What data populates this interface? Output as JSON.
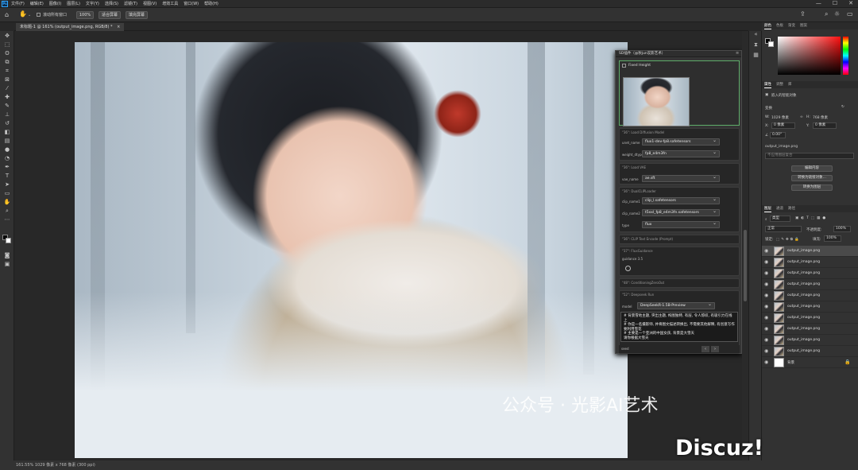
{
  "menubar": {
    "items": [
      "文件(F)",
      "编辑(E)",
      "图像(I)",
      "图层(L)",
      "文字(Y)",
      "选择(S)",
      "滤镜(T)",
      "视图(V)",
      "增效工具",
      "窗口(W)",
      "帮助(H)"
    ],
    "window_controls": [
      "—",
      "☐",
      "✕"
    ]
  },
  "options": {
    "scroll_all": "滚动所有窗口",
    "zoom": "100%",
    "fit_screen": "适合屏幕",
    "fill_screen": "填充屏幕"
  },
  "document_tab": {
    "label": "未标题-1 @ 161% (output_image.png, RGB/8) *",
    "close": "×"
  },
  "comfy": {
    "title": "SD插件（@秋jun炭影艺术）",
    "fixed_height": "Fixed Height",
    "nodes": [
      {
        "title": "\"36\": Load Diffusion Model",
        "fields": [
          {
            "label": "unet_name",
            "value": "flux1-dev-fp8.safetensors"
          },
          {
            "label": "weight_dtype",
            "value": "fp8_e4m3fn"
          }
        ]
      },
      {
        "title": "\"36\": Load VAE",
        "fields": [
          {
            "label": "vae_name",
            "value": "ae.sft"
          }
        ]
      },
      {
        "title": "\"36\": DualCLIPLoader",
        "fields": [
          {
            "label": "clip_name1",
            "value": "clip_l.safetensors"
          },
          {
            "label": "clip_name2",
            "value": "t5xxl_fp8_e4m3fn.safetensors"
          },
          {
            "label": "type",
            "value": "flux"
          }
        ]
      },
      {
        "title": "\"36\": CLIP Text Encode (Prompt)",
        "fields": []
      },
      {
        "title": "\"37\": FluxGuidance",
        "fields": [
          {
            "label": "guidance 3.5",
            "value": ""
          }
        ]
      },
      {
        "title": "\"48\": ConditioningZeroOut",
        "fields": []
      },
      {
        "title": "\"52\": Deepseek Run",
        "fields": [
          {
            "label": "model",
            "value": "DeepSeekR-1.5B-Preview"
          }
        ]
      }
    ],
    "prompt_text": "# 背景雪地主题, 突出主题, 构图独特, 有层, 令人惊叹, 有吸引力在线上\n# 你是一名摄影师, 并将图文描述转换出, 不需要其他解释, 有创意写作要利用雪花\n# 主要是一个亚洲的中国女孩, 背景是大雪天\n请你根据大雪天",
    "seed_label": "seed"
  },
  "right": {
    "color_tabs": [
      "颜色",
      "色板",
      "渐变",
      "图案"
    ],
    "prop_tabs": [
      "属性",
      "调整",
      "库"
    ],
    "smart_object": "嵌入的智能对象",
    "transform": "变换",
    "w_label": "W:",
    "w_value": "1029 像素",
    "h_label": "H:",
    "h_value": "768 像素",
    "x_label": "X:",
    "x_value": "0 像素",
    "y_label": "Y:",
    "y_value": "0 像素",
    "angle_value": "0.00°",
    "filename": "output_image.png",
    "layer_comp": "不应用图层复合",
    "btn_edit": "编辑内容",
    "btn_convert_linked": "转换为链接对象...",
    "btn_convert_layers": "转换为图层",
    "layer_tabs": [
      "图层",
      "通道",
      "路径"
    ],
    "kind_filter": "类型",
    "blend_mode": "正常",
    "opacity_label": "不透明度:",
    "opacity_value": "100%",
    "lock_label": "锁定:",
    "fill_label": "填充:",
    "fill_value": "100%",
    "layers": [
      "output_image.png",
      "output_image.png",
      "output_image.png",
      "output_image.png",
      "output_image.png",
      "output_image.png",
      "output_image.png",
      "output_image.png",
      "output_image.png",
      "output_image.png",
      "背景"
    ]
  },
  "status": {
    "text": "161.55%   1029 像素 x 768 像素 (300 ppi)"
  },
  "watermarks": {
    "wechat": "公众号 · 光影AI艺术",
    "discuz": "Discuz!"
  },
  "colors": {
    "accent": "#31a8ff",
    "panel": "#323232",
    "canvas": "#282828"
  }
}
